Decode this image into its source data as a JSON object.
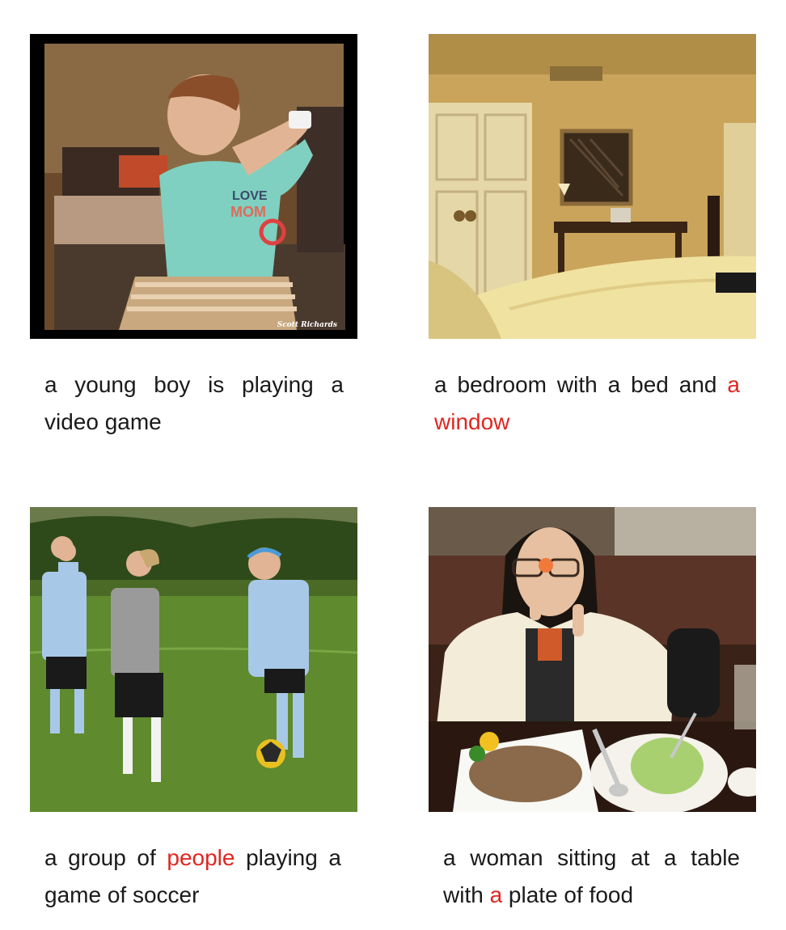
{
  "panels": [
    {
      "id": "boy",
      "caption": [
        {
          "text": "a young boy is playing a video game",
          "highlight": false
        }
      ],
      "photo_watermark": "Scott Richards",
      "shirt_text": [
        "LOVE",
        "MOM"
      ]
    },
    {
      "id": "bedroom",
      "caption": [
        {
          "text": "a bedroom with a bed and ",
          "highlight": false
        },
        {
          "text": "a window",
          "highlight": true
        }
      ]
    },
    {
      "id": "soccer",
      "caption": [
        {
          "text": "a group of ",
          "highlight": false
        },
        {
          "text": "people",
          "highlight": true
        },
        {
          "text": " playing a game of soccer",
          "highlight": false
        }
      ]
    },
    {
      "id": "woman",
      "caption": [
        {
          "text": "a woman sitting at a table with ",
          "highlight": false
        },
        {
          "text": "a",
          "highlight": true
        },
        {
          "text": " plate of food",
          "highlight": false
        }
      ]
    }
  ],
  "colors": {
    "caption_text": "#1a1a1a",
    "highlight": "#e0261f"
  }
}
